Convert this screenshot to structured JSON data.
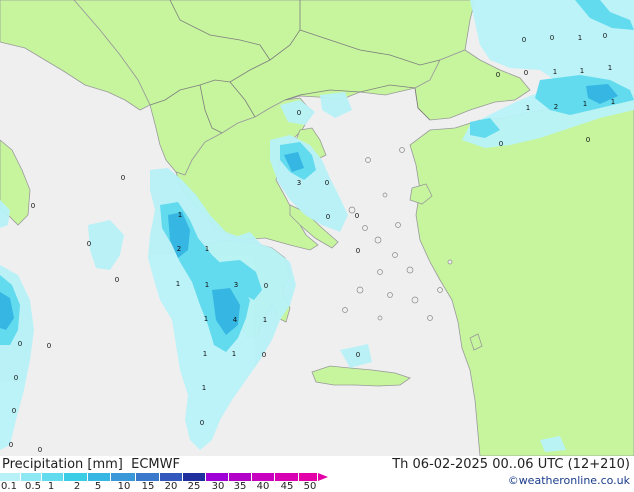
{
  "title": "Precipitation [mm]",
  "model": "ECMWF",
  "valid_time": "Th 06-02-2025 00..06 UTC (12+210)",
  "credit": "©weatheronline.co.uk",
  "legend": {
    "unit": "mm",
    "ticks": [
      "0.1",
      "0.5",
      "1",
      "2",
      "5",
      "10",
      "15",
      "20",
      "25",
      "30",
      "35",
      "40",
      "45",
      "50"
    ],
    "colors": [
      "#b8f2f8",
      "#8ee8f4",
      "#62dbee",
      "#3ccde6",
      "#36b6e2",
      "#3a98d8",
      "#3a78cc",
      "#3358bd",
      "#1f2f9e",
      "#9f00d8",
      "#b300c9",
      "#c800c0",
      "#d800b3",
      "#e400a8"
    ],
    "overflow_color": "#e400a8"
  },
  "colors": {
    "sea": "#efefef",
    "land": "#c6f59e",
    "border": "#9a9a9a"
  },
  "values": {
    "north_sea": "0",
    "bulgaria": "1",
    "istanbul_a": "1",
    "istanbul_b": "0",
    "istanbul_c": "1",
    "marmara_a": "0",
    "marmara_b": "1",
    "marmara_c": "2",
    "marmara_d": "0",
    "anatolia": "0",
    "north_greece": "0",
    "chalkidiki": "3",
    "thasos": "0",
    "aegean_mid": "0",
    "aegean_w": "0",
    "euboea": "0",
    "corfu": "1",
    "epirus": "2",
    "ionian_w": "0",
    "lefkada": "1",
    "kefalonia": "1",
    "gulf_corinth": "3",
    "peloponnese": "0",
    "zakynthos": "1",
    "ionian_s": "4",
    "taygetos": "1",
    "cyclades": "0",
    "ionian_far_a": "1",
    "ionian_far_b": "1",
    "kythira": "0",
    "crete": "0",
    "ionian_low": "1",
    "malta_area": "0",
    "libya_a": "0",
    "libya_b": "0",
    "calabria_a": "0",
    "calabria_b": "0",
    "sicily_a": "0",
    "sicily_b": "0",
    "puglia": "0",
    "ionian_mid": "0"
  }
}
